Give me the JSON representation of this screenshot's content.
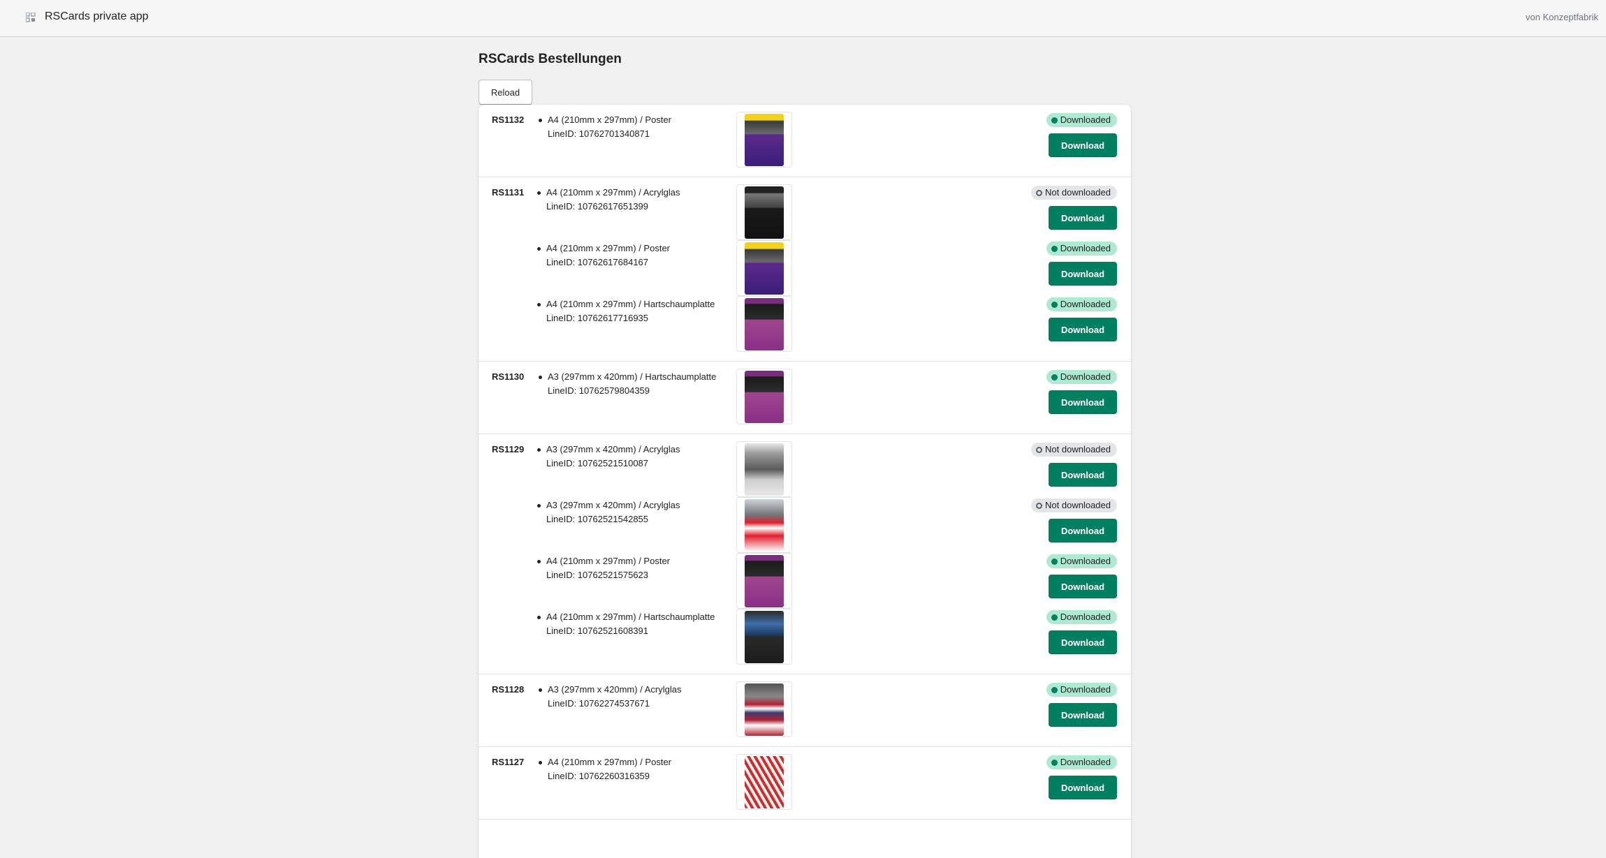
{
  "header": {
    "app_title": "RSCards private app",
    "by_text": "von Konzeptfabrik"
  },
  "page": {
    "title": "RSCards Bestellungen",
    "reload_label": "Reload"
  },
  "labels": {
    "download": "Download",
    "downloaded": "Downloaded",
    "not_downloaded": "Not downloaded"
  },
  "colors": {
    "primary_button": "#008060",
    "downloaded_badge": "#aee9d1",
    "not_downloaded_badge": "#e4e5e7"
  },
  "orders": [
    {
      "id": "RS1132",
      "lines": [
        {
          "title": "A4 (210mm x 297mm) / Poster",
          "line_id": "LineID: 10762701340871",
          "status": "Downloaded",
          "thumb": "yellow-card"
        }
      ]
    },
    {
      "id": "RS1131",
      "lines": [
        {
          "title": "A4 (210mm x 297mm) / Acrylglas",
          "line_id": "LineID: 10762617651399",
          "status": "Not downloaded",
          "thumb": "dark-card"
        },
        {
          "title": "A4 (210mm x 297mm) / Poster",
          "line_id": "LineID: 10762617684167",
          "status": "Downloaded",
          "thumb": "yellow-card"
        },
        {
          "title": "A4 (210mm x 297mm) / Hartschaumplatte",
          "line_id": "LineID: 10762617716935",
          "status": "Downloaded",
          "thumb": "purple-card"
        }
      ]
    },
    {
      "id": "RS1130",
      "lines": [
        {
          "title": "A3 (297mm x 420mm) / Hartschaumplatte",
          "line_id": "LineID: 10762579804359",
          "status": "Downloaded",
          "thumb": "purple-card"
        }
      ]
    },
    {
      "id": "RS1129",
      "lines": [
        {
          "title": "A3 (297mm x 420mm) / Acrylglas",
          "line_id": "LineID: 10762521510087",
          "status": "Not downloaded",
          "thumb": "grey-card"
        },
        {
          "title": "A3 (297mm x 420mm) / Acrylglas",
          "line_id": "LineID: 10762521542855",
          "status": "Not downloaded",
          "thumb": "red-card"
        },
        {
          "title": "A4 (210mm x 297mm) / Poster",
          "line_id": "LineID: 10762521575623",
          "status": "Downloaded",
          "thumb": "purple-card"
        },
        {
          "title": "A4 (210mm x 297mm) / Hartschaumplatte",
          "line_id": "LineID: 10762521608391",
          "status": "Downloaded",
          "thumb": "blue-card"
        }
      ]
    },
    {
      "id": "RS1128",
      "lines": [
        {
          "title": "A3 (297mm x 420mm) / Acrylglas",
          "line_id": "LineID: 10762274537671",
          "status": "Downloaded",
          "thumb": "flag-card"
        }
      ]
    },
    {
      "id": "RS1127",
      "lines": [
        {
          "title": "A4 (210mm x 297mm) / Poster",
          "line_id": "LineID: 10762260316359",
          "status": "Downloaded",
          "thumb": "sun-card"
        }
      ]
    }
  ]
}
